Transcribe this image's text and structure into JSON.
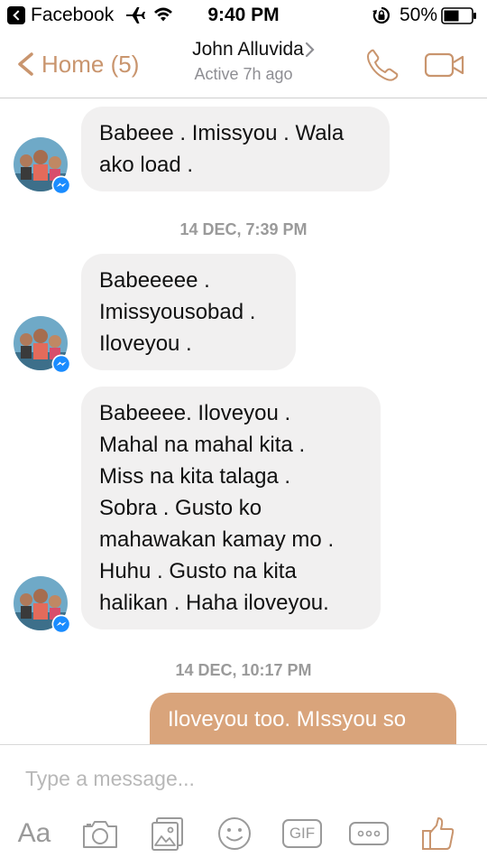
{
  "status_bar": {
    "back_app": "Facebook",
    "time": "9:40 PM",
    "battery": "50%"
  },
  "header": {
    "back_label": "Home (5)",
    "contact_name": "John Alluvida",
    "contact_status": "Active 7h ago"
  },
  "thread": {
    "messages": [
      {
        "from": "them",
        "text_lines": [
          "Babeee . Imissyou . Wala",
          "ako load ."
        ]
      },
      {
        "timestamp": "14 DEC, 7:39 PM"
      },
      {
        "from": "them",
        "text_lines": [
          "Babeeeee .",
          "Imissyousobad .",
          "Iloveyou ."
        ]
      },
      {
        "from": "them",
        "text_lines": [
          "Babeeee. Iloveyou .",
          "Mahal na mahal kita .",
          "Miss na kita talaga .",
          "Sobra . Gusto ko",
          "mahawakan kamay mo .",
          "Huhu . Gusto na kita",
          "halikan . Haha iloveyou."
        ]
      },
      {
        "timestamp": "14 DEC, 10:17 PM"
      },
      {
        "from": "me",
        "text_lines": [
          "Iloveyou too. MIssyou so"
        ]
      }
    ]
  },
  "composer": {
    "placeholder": "Type a message...",
    "aa_label": "Aa",
    "gif_label": "GIF"
  },
  "colors": {
    "accent": "#c9956e",
    "outgoing_bubble": "#d9a47b",
    "incoming_bubble": "#f1f0f0",
    "messenger_badge": "#1a8cff"
  },
  "icons": [
    "back-chevron-icon",
    "airplane-icon",
    "wifi-icon",
    "rotation-lock-icon",
    "battery-icon",
    "phone-icon",
    "video-call-icon",
    "camera-icon",
    "photo-gallery-icon",
    "emoji-icon",
    "more-icon",
    "like-icon",
    "messenger-badge-icon"
  ]
}
